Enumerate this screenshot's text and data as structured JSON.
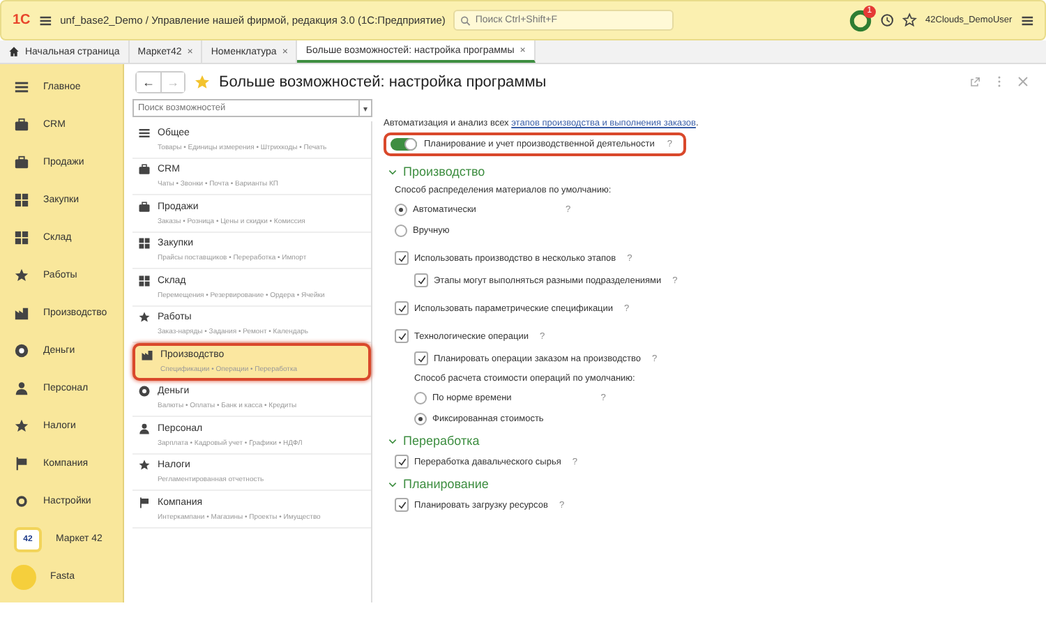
{
  "window": {
    "logo": "1С",
    "title": "unf_base2_Demo / Управление нашей фирмой, редакция 3.0  (1С:Предприятие)",
    "search": {
      "placeholder": "Поиск Ctrl+Shift+F"
    },
    "notification_count": "1",
    "user": "42Clouds_DemoUser"
  },
  "tabs": [
    {
      "label": "Начальная страница",
      "kind": "home",
      "selected": false
    },
    {
      "label": "Маркет42",
      "kind": "doc",
      "close": "×",
      "selected": false
    },
    {
      "label": "Номенклатура",
      "kind": "doc",
      "close": "×",
      "selected": false
    },
    {
      "label": "Больше возможностей: настройка программы",
      "kind": "doc",
      "close": "×",
      "selected": true
    }
  ],
  "sidebar": {
    "items": [
      {
        "label": "Главное",
        "kind": "icon"
      },
      {
        "label": "CRM",
        "kind": "icon"
      },
      {
        "label": "Продажи",
        "kind": "icon"
      },
      {
        "label": "Закупки",
        "kind": "icon"
      },
      {
        "label": "Склад",
        "kind": "icon"
      },
      {
        "label": "Работы",
        "kind": "icon"
      },
      {
        "label": "Производство",
        "kind": "icon"
      },
      {
        "label": "Деньги",
        "kind": "icon"
      },
      {
        "label": "Персонал",
        "kind": "icon"
      },
      {
        "label": "Налоги",
        "kind": "icon"
      },
      {
        "label": "Компания",
        "kind": "icon"
      },
      {
        "label": "Настройки",
        "kind": "icon"
      },
      {
        "label": "Маркет 42",
        "kind": "badge",
        "badge": "42"
      },
      {
        "label": "Fasta",
        "kind": "circle"
      }
    ]
  },
  "form": {
    "back": "←",
    "forward": "→",
    "title": "Больше возможностей: настройка программы",
    "search": {
      "placeholder": "Поиск возможностей",
      "dropdown": "▾"
    },
    "features": [
      {
        "title": "Общее",
        "subtitle": "Товары • Единицы измерения • Штрихкоды • Печать",
        "selected": false,
        "highlighted": false
      },
      {
        "title": "CRM",
        "subtitle": "Чаты • Звонки • Почта • Варианты КП",
        "selected": false,
        "highlighted": false
      },
      {
        "title": "Продажи",
        "subtitle": "Заказы • Розница • Цены и скидки • Комиссия",
        "selected": false,
        "highlighted": false
      },
      {
        "title": "Закупки",
        "subtitle": "Прайсы поставщиков • Переработка • Импорт",
        "selected": false,
        "highlighted": false
      },
      {
        "title": "Склад",
        "subtitle": "Перемещения • Резервирование • Ордера • Ячейки",
        "selected": false,
        "highlighted": false
      },
      {
        "title": "Работы",
        "subtitle": "Заказ-наряды • Задания • Ремонт • Календарь",
        "selected": false,
        "highlighted": false
      },
      {
        "title": "Производство",
        "subtitle": "Спецификации • Операции • Переработка",
        "selected": true,
        "highlighted": true
      },
      {
        "title": "Деньги",
        "subtitle": "Валюты • Оплаты • Банк и касса • Кредиты",
        "selected": false,
        "highlighted": false
      },
      {
        "title": "Персонал",
        "subtitle": "Зарплата • Кадровый учет • Графики • НДФЛ",
        "selected": false,
        "highlighted": false
      },
      {
        "title": "Налоги",
        "subtitle": "Регламентированная отчетность",
        "selected": false,
        "highlighted": false
      },
      {
        "title": "Компания",
        "subtitle": "Интеркампани • Магазины • Проекты • Имущество",
        "selected": false,
        "highlighted": false
      }
    ],
    "intro": {
      "text": "Автоматизация и анализ всех ",
      "link": "этапов производства и выполнения заказов",
      "end": "."
    },
    "toggle": {
      "label": "Планирование и учет производственной деятельности",
      "help": "?",
      "on": true,
      "highlighted": true
    },
    "sections": [
      {
        "title": "Производство",
        "expanded": true,
        "items": [
          {
            "kind": "label",
            "label": "Способ распределения материалов по умолчанию:"
          },
          {
            "kind": "radio",
            "label": "Автоматически",
            "selected": true,
            "help": "?"
          },
          {
            "kind": "radio",
            "label": "Вручную",
            "selected": false
          },
          {
            "kind": "checkbox",
            "label": "Использовать производство в несколько этапов",
            "checked": true,
            "help": "?",
            "children": [
              {
                "kind": "checkbox",
                "label": "Этапы могут выполняться разными подразделениями",
                "checked": true,
                "help": "?"
              }
            ]
          },
          {
            "kind": "checkbox",
            "label": "Использовать параметрические спецификации",
            "checked": true,
            "help": "?"
          },
          {
            "kind": "checkbox",
            "label": "Технологические операции",
            "checked": true,
            "help": "?",
            "children": [
              {
                "kind": "checkbox",
                "label": "Планировать операции заказом на производство",
                "checked": true,
                "help": "?"
              },
              {
                "kind": "label",
                "label": "Способ расчета стоимости операций по умолчанию:"
              },
              {
                "kind": "radio",
                "label": "По норме времени",
                "selected": false,
                "help": "?"
              },
              {
                "kind": "radio",
                "label": "Фиксированная стоимость",
                "selected": true
              }
            ]
          }
        ]
      },
      {
        "title": "Переработка",
        "expanded": true,
        "items": [
          {
            "kind": "checkbox",
            "label": "Переработка давальческого сырья",
            "checked": true,
            "help": "?"
          }
        ]
      },
      {
        "title": "Планирование",
        "expanded": true,
        "items": [
          {
            "kind": "checkbox",
            "label": "Планировать загрузку ресурсов",
            "checked": true,
            "help": "?"
          }
        ]
      }
    ]
  }
}
